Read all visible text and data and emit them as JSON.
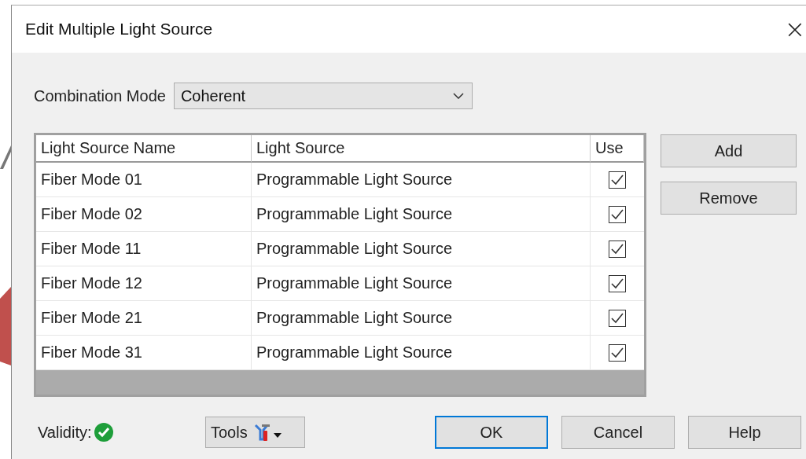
{
  "window": {
    "title": "Edit Multiple Light Source",
    "close": "×"
  },
  "combination_mode": {
    "label": "Combination Mode",
    "value": "Coherent"
  },
  "table": {
    "columns": [
      "Light Source Name",
      "Light Source",
      "Use"
    ],
    "rows": [
      {
        "name": "Fiber Mode 01",
        "source": "Programmable Light Source",
        "checked": true
      },
      {
        "name": "Fiber Mode 02",
        "source": "Programmable Light Source",
        "checked": true
      },
      {
        "name": "Fiber Mode 11",
        "source": "Programmable Light Source",
        "checked": true
      },
      {
        "name": "Fiber Mode 12",
        "source": "Programmable Light Source",
        "checked": true
      },
      {
        "name": "Fiber Mode 21",
        "source": "Programmable Light Source",
        "checked": true
      },
      {
        "name": "Fiber Mode 31",
        "source": "Programmable Light Source",
        "checked": true
      }
    ]
  },
  "side_buttons": [
    "Add",
    "Remove"
  ],
  "validity": {
    "label": "Validity:",
    "valid": true
  },
  "tools_button": "Tools",
  "buttons": [
    {
      "label": "OK",
      "focused": true
    },
    {
      "label": "Cancel",
      "focused": false
    },
    {
      "label": "Help",
      "focused": false
    }
  ]
}
